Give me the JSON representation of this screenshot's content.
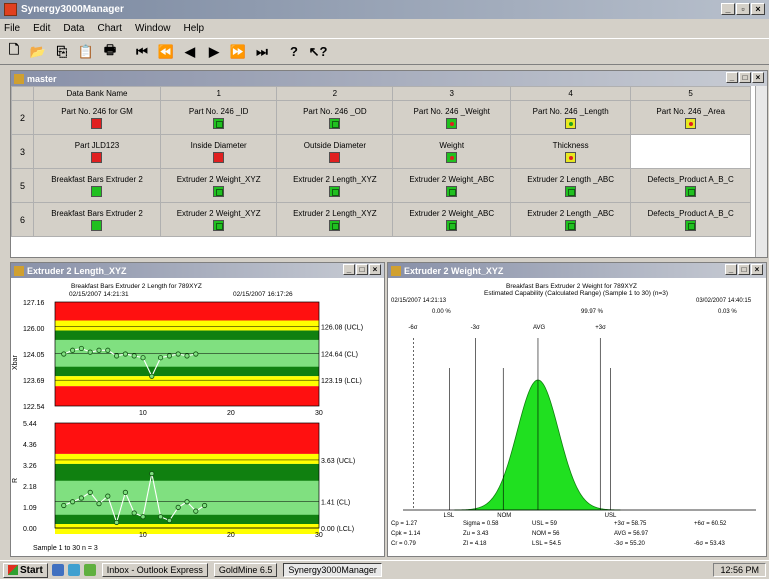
{
  "app": {
    "title": "Synergy3000Manager"
  },
  "menu": [
    "File",
    "Edit",
    "Data",
    "Chart",
    "Window",
    "Help"
  ],
  "master": {
    "title": "master",
    "headers": [
      "Data Bank Name",
      "1",
      "2",
      "3",
      "4",
      "5"
    ],
    "rows": [
      {
        "num": "2",
        "cells": [
          {
            "label": "Part No. 246 for GM",
            "status": "red"
          },
          {
            "label": "Part No. 246 _ID",
            "status": "greenin"
          },
          {
            "label": "Part No. 246 _OD",
            "status": "greenin"
          },
          {
            "label": "Part No. 246 _Weight",
            "status": "greenred"
          },
          {
            "label": "Part No. 246 _Length",
            "status": "yellowgreen"
          },
          {
            "label": "Part No. 246 _Area",
            "status": "yellowred"
          }
        ]
      },
      {
        "num": "3",
        "cells": [
          {
            "label": "Part JLD123",
            "status": "red"
          },
          {
            "label": "Inside Diameter",
            "status": "red"
          },
          {
            "label": "Outside Diameter",
            "status": "red"
          },
          {
            "label": "Weight",
            "status": "greenred"
          },
          {
            "label": "Thickness",
            "status": "yellowred"
          },
          {
            "label": "",
            "status": "none"
          }
        ]
      },
      {
        "num": "5",
        "cells": [
          {
            "label": "Breakfast Bars Extruder 2",
            "status": "green"
          },
          {
            "label": "Extruder 2 Weight_XYZ",
            "status": "greenin"
          },
          {
            "label": "Extruder 2 Length_XYZ",
            "status": "greenin"
          },
          {
            "label": "Extruder 2 Weight_ABC",
            "status": "greenin"
          },
          {
            "label": "Extruder 2 Length _ABC",
            "status": "greenin"
          },
          {
            "label": "Defects_Product A_B_C",
            "status": "greenin"
          }
        ]
      },
      {
        "num": "6",
        "cells": [
          {
            "label": "Breakfast Bars Extruder 2",
            "status": "green"
          },
          {
            "label": "Extruder 2 Weight_XYZ",
            "status": "greenin"
          },
          {
            "label": "Extruder 2 Length_XYZ",
            "status": "greenin"
          },
          {
            "label": "Extruder 2 Weight_ABC",
            "status": "greenin"
          },
          {
            "label": "Extruder 2 Length _ABC",
            "status": "greenin"
          },
          {
            "label": "Defects_Product A_B_C",
            "status": "greenin"
          }
        ]
      }
    ]
  },
  "xbar_window": {
    "title": "Extruder 2 Length_XYZ"
  },
  "hist_window": {
    "title": "Extruder 2 Weight_XYZ"
  },
  "chart_data": [
    {
      "type": "line",
      "title": "Breakfast Bars Extruder 2 Length for 789XYZ",
      "date_start": "02/15/2007 14:21:31",
      "date_end": "02/15/2007 16:17:26",
      "ylabel": "Xbar",
      "xlim": [
        0,
        30
      ],
      "x_ticks": [
        "10",
        "20",
        "30"
      ],
      "y_ticks": [
        "127.16",
        "126.00",
        "124.05",
        "123.69",
        "122.54"
      ],
      "ylim": [
        121.8,
        127.4
      ],
      "limits": [
        "126.08 (UCL)",
        "124.64 (CL)",
        "123.19 (LCL)"
      ],
      "ucl": 126.08,
      "cl": 124.64,
      "lcl": 123.19,
      "values": [
        124.6,
        124.8,
        124.9,
        124.7,
        124.8,
        124.8,
        124.5,
        124.6,
        124.5,
        124.4,
        123.4,
        124.4,
        124.5,
        124.6,
        124.5,
        124.6
      ]
    },
    {
      "type": "line",
      "ylabel": "R",
      "xlabel": "Sample 1 to 30  n = 3",
      "xlim": [
        0,
        30
      ],
      "x_ticks": [
        "10",
        "20",
        "30"
      ],
      "y_ticks": [
        "5.44",
        "4.36",
        "3.26",
        "2.18",
        "1.09",
        "0.00"
      ],
      "ylim": [
        0,
        5.6
      ],
      "limits": [
        "3.63 (UCL)",
        "1.41 (CL)",
        "0.00 (LCL)"
      ],
      "ucl": 3.63,
      "cl": 1.41,
      "lcl": 0.0,
      "values": [
        1.2,
        1.4,
        1.6,
        1.9,
        1.3,
        1.7,
        0.3,
        1.9,
        0.8,
        0.6,
        2.9,
        0.6,
        0.4,
        1.1,
        1.4,
        0.9,
        1.2
      ]
    },
    {
      "type": "area",
      "title": "Breakfast Bars Extruder 2 Weight for 789XYZ",
      "subtitle": "Estimated Capability (Calculated Range) (Sample 1 to 30) (n=3)",
      "date_start": "02/15/2007 14:21:13",
      "date_end": "03/02/2007 14:40:15",
      "pct_low": "0.00 %",
      "pct_mid": "99.97 %",
      "pct_high": "0.03 %",
      "markers": [
        "-6σ",
        "-3σ",
        "AVG",
        "+3σ"
      ],
      "axis_labels": [
        "LSL",
        "NOM",
        "USL"
      ],
      "stats": [
        [
          "Cp = 1.27",
          "Sigma = 0.58",
          "USL = 59",
          "+3σ = 58.75",
          "+6σ = 60.52"
        ],
        [
          "Cpk = 1.14",
          "Zu = 3.43",
          "NOM = 56",
          "AVG = 56.97",
          ""
        ],
        [
          "Cr = 0.79",
          "Zl = 4.18",
          "LSL = 54.5",
          "-3σ = 55.20",
          "-6σ = 53.43"
        ]
      ],
      "avg": 56.97,
      "sigma": 0.58,
      "lsl": 54.5,
      "nom": 56,
      "usl": 59
    }
  ],
  "taskbar": {
    "start": "Start",
    "items": [
      "Inbox - Outlook Express",
      "GoldMine 6.5",
      "Synergy3000Manager"
    ],
    "clock": "12:56 PM"
  }
}
